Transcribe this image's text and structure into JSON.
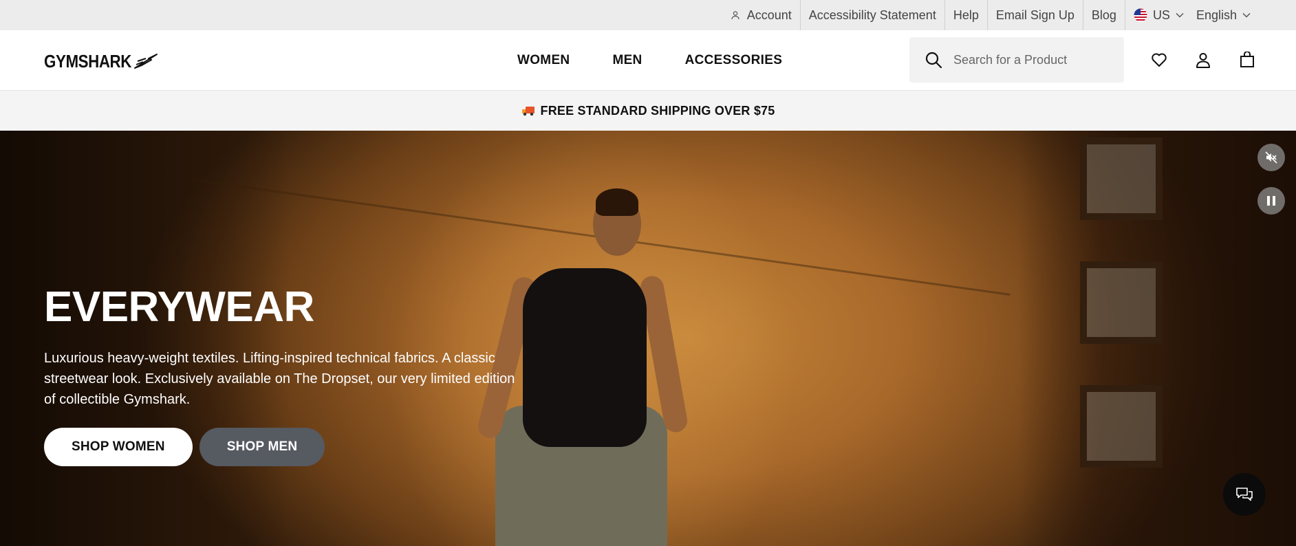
{
  "utility": {
    "account": "Account",
    "accessibility": "Accessibility Statement",
    "help": "Help",
    "email_signup": "Email Sign Up",
    "blog": "Blog",
    "region": "US",
    "language": "English"
  },
  "header": {
    "logo": "GYMSHARK",
    "nav": [
      "WOMEN",
      "MEN",
      "ACCESSORIES"
    ],
    "search_placeholder": "Search for a Product"
  },
  "promo": {
    "text": "FREE STANDARD SHIPPING OVER $75"
  },
  "hero": {
    "title": "EVERYWEAR",
    "description": "Luxurious heavy-weight textiles. Lifting-inspired technical fabrics. A classic streetwear look. Exclusively available on The Dropset, our very limited edition of collectible Gymshark.",
    "shop_women": "SHOP WOMEN",
    "shop_men": "SHOP MEN"
  },
  "icons": {
    "account": "user-icon",
    "region": "us-flag-icon",
    "search": "search-icon",
    "wishlist": "heart-icon",
    "profile": "profile-icon",
    "bag": "shopping-bag-icon",
    "promo": "truck-icon",
    "mute": "mute-icon",
    "pause": "pause-icon",
    "chat": "chat-icon"
  },
  "colors": {
    "utility_bg": "#ececec",
    "promo_bg": "#f4f4f4",
    "btn_white": "#ffffff",
    "btn_grey": "#565a61",
    "chat_bg": "#0b0b0b"
  }
}
